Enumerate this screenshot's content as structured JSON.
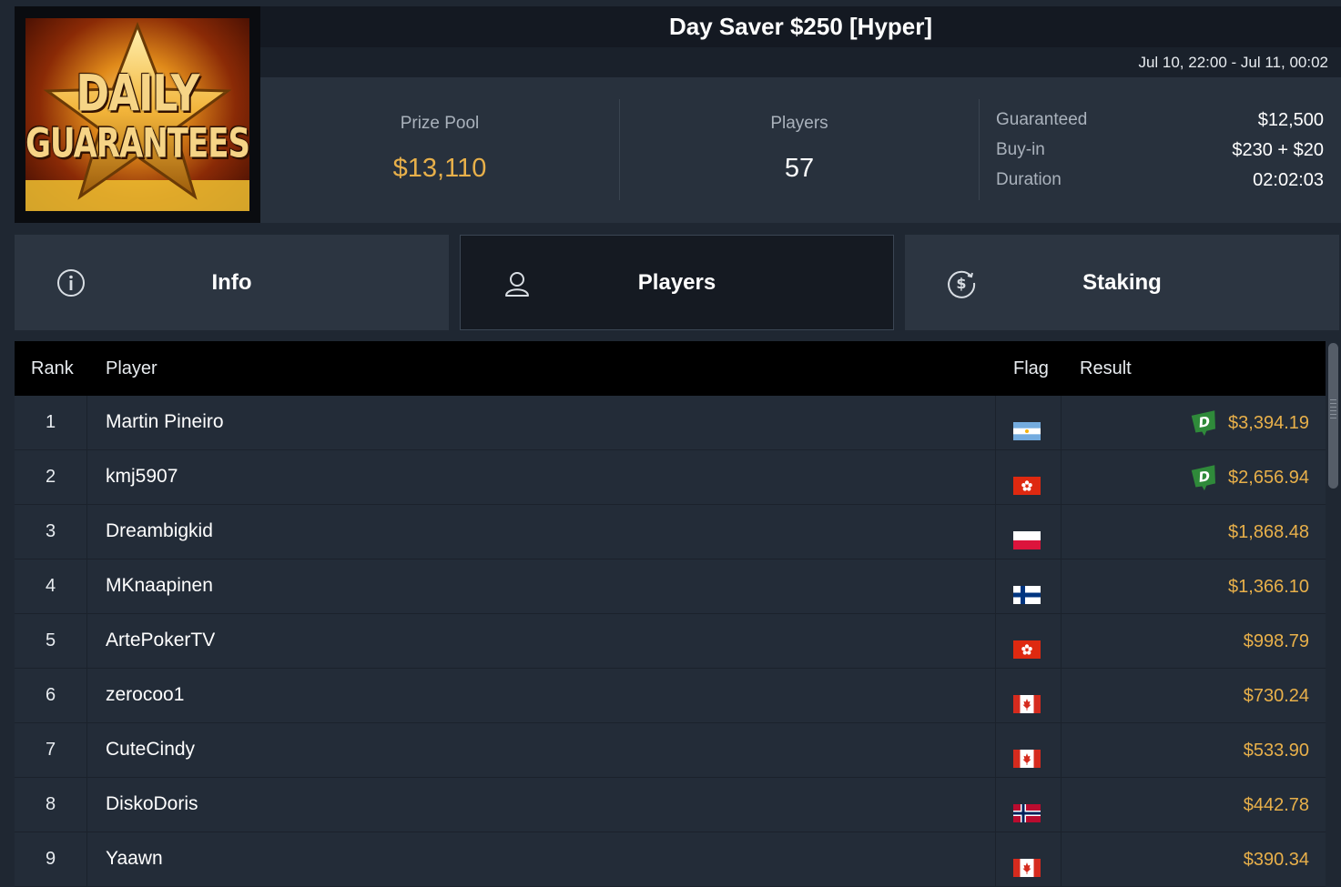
{
  "logo": {
    "line1": "DAILY",
    "line2": "GUARANTEES"
  },
  "tournament": {
    "title": "Day Saver $250 [Hyper]",
    "dates": "Jul 10, 22:00 - Jul 11, 00:02"
  },
  "stats": {
    "prize_pool_label": "Prize Pool",
    "prize_pool_value": "$13,110",
    "players_label": "Players",
    "players_value": "57",
    "details": [
      {
        "key": "Guaranteed",
        "value": "$12,500"
      },
      {
        "key": "Buy-in",
        "value": "$230 + $20"
      },
      {
        "key": "Duration",
        "value": "02:02:03"
      }
    ]
  },
  "tabs": [
    {
      "label": "Info",
      "icon": "info-icon",
      "active": false
    },
    {
      "label": "Players",
      "icon": "user-icon",
      "active": true
    },
    {
      "label": "Staking",
      "icon": "dollar-coin-icon",
      "active": false
    }
  ],
  "table": {
    "headers": {
      "rank": "Rank",
      "player": "Player",
      "flag": "Flag",
      "result": "Result"
    },
    "rows": [
      {
        "rank": "1",
        "player": "Martin Pineiro",
        "flag": "argentina",
        "result": "$3,394.19",
        "badge": "D"
      },
      {
        "rank": "2",
        "player": "kmj5907",
        "flag": "hong-kong",
        "result": "$2,656.94",
        "badge": "D"
      },
      {
        "rank": "3",
        "player": "Dreambigkid",
        "flag": "poland",
        "result": "$1,868.48",
        "badge": ""
      },
      {
        "rank": "4",
        "player": "MKnaapinen",
        "flag": "finland",
        "result": "$1,366.10",
        "badge": ""
      },
      {
        "rank": "5",
        "player": "ArtePokerTV",
        "flag": "hong-kong",
        "result": "$998.79",
        "badge": ""
      },
      {
        "rank": "6",
        "player": "zerocoo1",
        "flag": "canada",
        "result": "$730.24",
        "badge": ""
      },
      {
        "rank": "7",
        "player": "CuteCindy",
        "flag": "canada",
        "result": "$533.90",
        "badge": ""
      },
      {
        "rank": "8",
        "player": "DiskoDoris",
        "flag": "norway",
        "result": "$442.78",
        "badge": ""
      },
      {
        "rank": "9",
        "player": "Yaawn",
        "flag": "canada",
        "result": "$390.34",
        "badge": ""
      }
    ]
  },
  "colors": {
    "accent_gold": "#e8b04a",
    "background": "#1f2732",
    "badge_green": "#2f8a3a"
  }
}
